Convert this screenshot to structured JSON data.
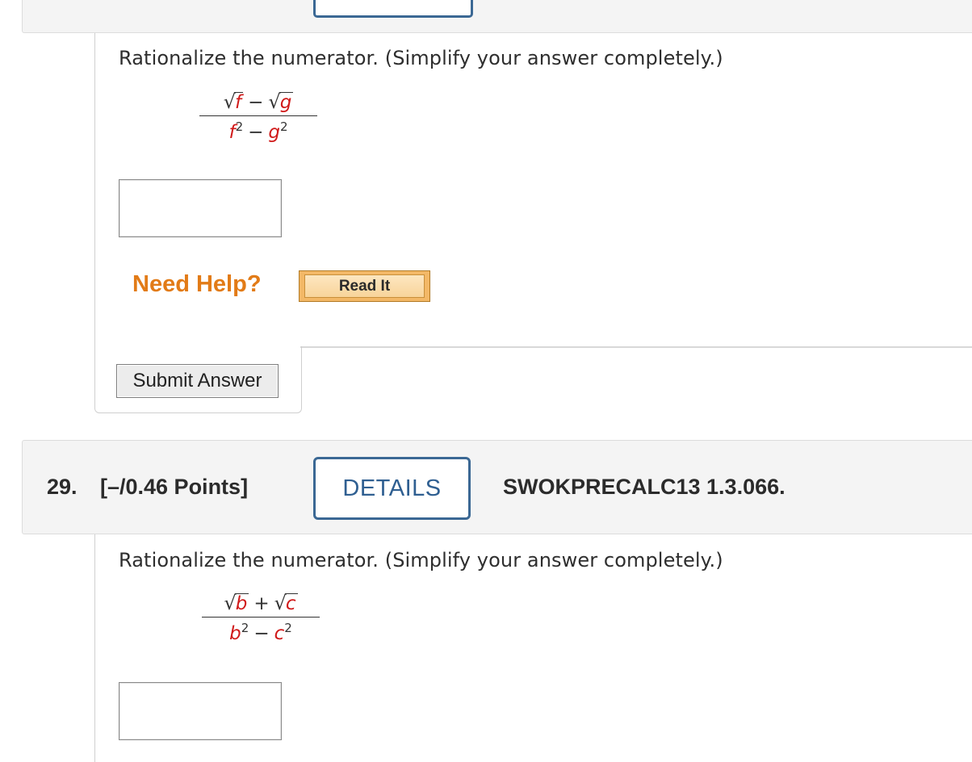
{
  "previous_question": {
    "instruction": "Rationalize the numerator. (Simplify your answer completely.)",
    "expression": {
      "num_var1": "f",
      "num_op": "−",
      "num_var2": "g",
      "den_var1": "f",
      "den_exp1": "2",
      "den_op": "−",
      "den_var2": "g",
      "den_exp2": "2"
    },
    "answer_value": "",
    "need_help_label": "Need Help?",
    "read_it_label": "Read It",
    "submit_label": "Submit Answer"
  },
  "question": {
    "number": "29.",
    "points": "[–/0.46 Points]",
    "details_label": "DETAILS",
    "code": "SWOKPRECALC13 1.3.066.",
    "instruction": "Rationalize the numerator. (Simplify your answer completely.)",
    "expression": {
      "num_var1": "b",
      "num_op": "+",
      "num_var2": "c",
      "den_var1": "b",
      "den_exp1": "2",
      "den_op": "−",
      "den_var2": "c",
      "den_exp2": "2"
    },
    "answer_value": ""
  },
  "colors": {
    "variable": "#d01a1a",
    "need_help": "#e27b17",
    "details_border": "#3b6894",
    "header_bg": "#f4f4f4"
  }
}
